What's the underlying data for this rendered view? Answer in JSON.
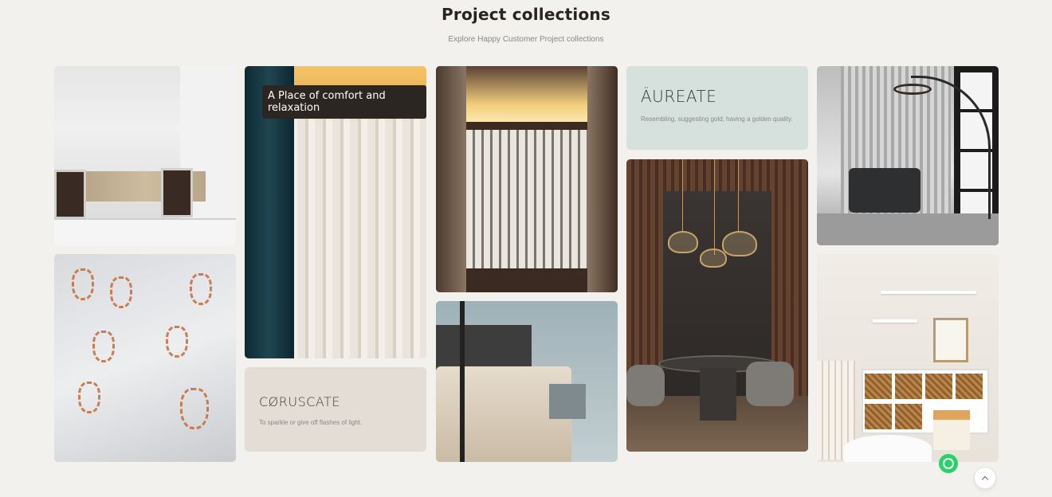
{
  "section": {
    "title": "Project collections",
    "subtitle": "Explore Happy Customer Project collections"
  },
  "cards": {
    "kitchen": {
      "icon": "kitchen-photo"
    },
    "handprints": {
      "icon": "handprint-wall-photo"
    },
    "curtain": {
      "icon": "curtain-photo",
      "banner": "A Place of comfort and relaxation"
    },
    "lace": {
      "icon": "sheer-curtain-photo"
    },
    "bedroom": {
      "icon": "bedroom-photo"
    },
    "dining": {
      "icon": "dining-room-photo"
    },
    "lounge": {
      "icon": "lounge-chair-photo"
    },
    "nursery": {
      "icon": "nursery-photo"
    }
  },
  "collections": {
    "coruscate": {
      "title": "CØRUSCATE",
      "desc": "To sparkle or give off flashes of light."
    },
    "aureate": {
      "title": "ÄUREATE",
      "desc": "Resembling, suggesting gold; having a golden quality."
    }
  },
  "floating": {
    "whatsapp_icon": "whatsapp-icon",
    "back_to_top_icon": "chevron-up-icon"
  },
  "colors": {
    "background": "#f3f1ee",
    "aureate_card": "#d6e1dd",
    "coruscate_card": "#e4ddd6",
    "whatsapp": "#25d366"
  }
}
